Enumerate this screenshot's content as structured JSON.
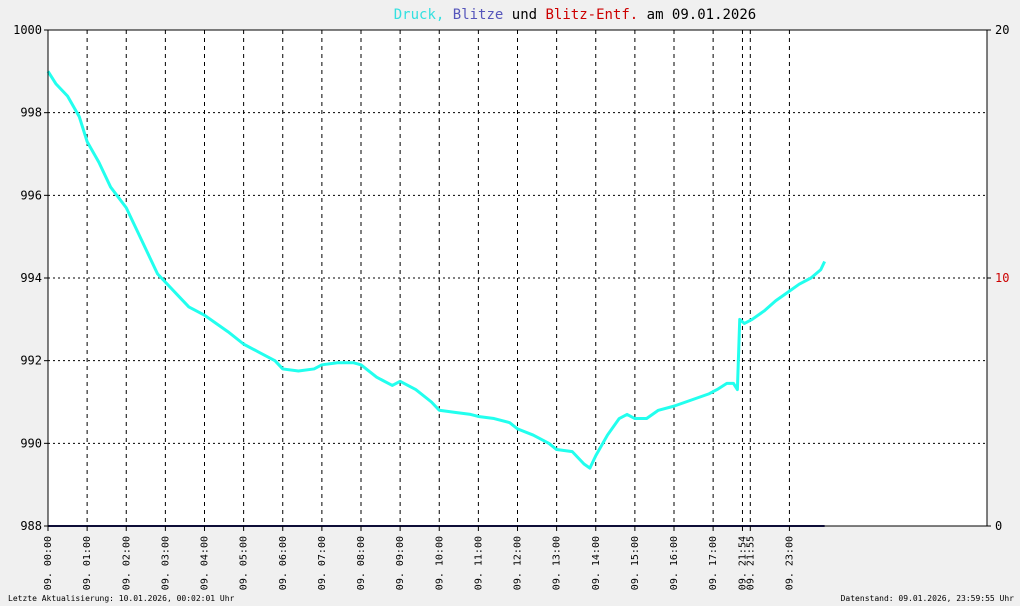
{
  "title": {
    "parts": [
      {
        "text": "Druck",
        "color": "#33e0e0"
      },
      {
        "text": ", ",
        "color": "#33e0e0"
      },
      {
        "text": "Blitze",
        "color": "#5555bb"
      },
      {
        "text": " und ",
        "color": "#000000"
      },
      {
        "text": "Blitz-Entf.",
        "color": "#cc0000"
      },
      {
        "text": " am 09.01.2026",
        "color": "#000000"
      }
    ]
  },
  "footer": {
    "left": "Letzte Aktualisierung: 10.01.2026, 00:02:01 Uhr",
    "right": "Datenstand: 09.01.2026, 23:59:55 Uhr"
  },
  "colors": {
    "pressure": "#22ffee",
    "lightning": "#1a1a6e",
    "distance_label": "#cc0000",
    "grid": "#000000",
    "background": "#ffffff"
  },
  "chart_data": {
    "type": "line",
    "x_unit": "hour of day",
    "xlim": [
      0,
      24
    ],
    "ylim_left": [
      988,
      1000
    ],
    "ylim_right": [
      0,
      20
    ],
    "y_ticks_left": [
      "1000",
      "998",
      "996",
      "994",
      "992",
      "990",
      "988"
    ],
    "y_ticks_right": [
      {
        "value": 20,
        "label": "20",
        "color": "#000000"
      },
      {
        "value": 10,
        "label": "10",
        "color": "#cc0000"
      },
      {
        "value": 0,
        "label": "0",
        "color": "#000000"
      }
    ],
    "x_ticks": [
      {
        "x": 0,
        "label": "09. 00:00"
      },
      {
        "x": 1,
        "label": "09. 01:00"
      },
      {
        "x": 2,
        "label": "09. 02:00"
      },
      {
        "x": 3,
        "label": "09. 03:00"
      },
      {
        "x": 4,
        "label": "09. 04:00"
      },
      {
        "x": 5,
        "label": "09. 05:00"
      },
      {
        "x": 6,
        "label": "09. 06:00"
      },
      {
        "x": 7,
        "label": "09. 07:00"
      },
      {
        "x": 8,
        "label": "09. 08:00"
      },
      {
        "x": 9,
        "label": "09. 09:00"
      },
      {
        "x": 10,
        "label": "09. 10:00"
      },
      {
        "x": 11,
        "label": "09. 11:00"
      },
      {
        "x": 12,
        "label": "09. 12:00"
      },
      {
        "x": 13,
        "label": "09. 13:00"
      },
      {
        "x": 14,
        "label": "09. 14:00"
      },
      {
        "x": 15,
        "label": "09. 15:00"
      },
      {
        "x": 16,
        "label": "09. 16:00"
      },
      {
        "x": 17,
        "label": "09. 17:00"
      },
      {
        "x": 17.75,
        "label": "09. 21:54"
      },
      {
        "x": 17.95,
        "label": "09. 21:55"
      },
      {
        "x": 18.95,
        "label": "09. 23:00"
      }
    ],
    "series": [
      {
        "name": "Druck",
        "axis": "left",
        "x": [
          0,
          0.2,
          0.5,
          0.8,
          1.0,
          1.3,
          1.6,
          2.0,
          2.3,
          2.6,
          2.8,
          3.0,
          3.3,
          3.6,
          4.0,
          4.3,
          4.6,
          5.0,
          5.4,
          5.8,
          6.0,
          6.4,
          6.8,
          7.0,
          7.4,
          7.8,
          8.0,
          8.4,
          8.8,
          9.0,
          9.4,
          9.8,
          10.0,
          10.4,
          10.8,
          11.0,
          11.4,
          11.8,
          12.0,
          12.4,
          12.8,
          13.0,
          13.4,
          13.7,
          13.85,
          14.0,
          14.3,
          14.6,
          14.8,
          15.0,
          15.3,
          15.6,
          16.0,
          16.3,
          16.6,
          16.9,
          17.1,
          17.35,
          17.52,
          17.62,
          17.68,
          17.8,
          18.0,
          18.3,
          18.6,
          18.9,
          19.2,
          19.5,
          19.75,
          19.85
        ],
        "values": [
          999.0,
          998.7,
          998.4,
          997.9,
          997.3,
          996.8,
          996.2,
          995.7,
          995.1,
          994.5,
          994.1,
          993.9,
          993.6,
          993.3,
          993.1,
          992.9,
          992.7,
          992.4,
          992.2,
          992.0,
          991.8,
          991.75,
          991.8,
          991.9,
          991.95,
          991.95,
          991.9,
          991.6,
          991.4,
          991.5,
          991.3,
          991.0,
          990.8,
          990.75,
          990.7,
          990.65,
          990.6,
          990.5,
          990.35,
          990.2,
          990.0,
          989.85,
          989.8,
          989.5,
          989.4,
          989.7,
          990.2,
          990.6,
          990.7,
          990.6,
          990.6,
          990.8,
          990.9,
          991.0,
          991.1,
          991.2,
          991.3,
          991.45,
          991.45,
          991.3,
          993.0,
          992.9,
          993.0,
          993.2,
          993.45,
          993.65,
          993.85,
          994.0,
          994.2,
          994.4
        ]
      },
      {
        "name": "Blitze",
        "axis": "right",
        "x": [
          0,
          19.85
        ],
        "values": [
          0,
          0
        ]
      }
    ]
  }
}
